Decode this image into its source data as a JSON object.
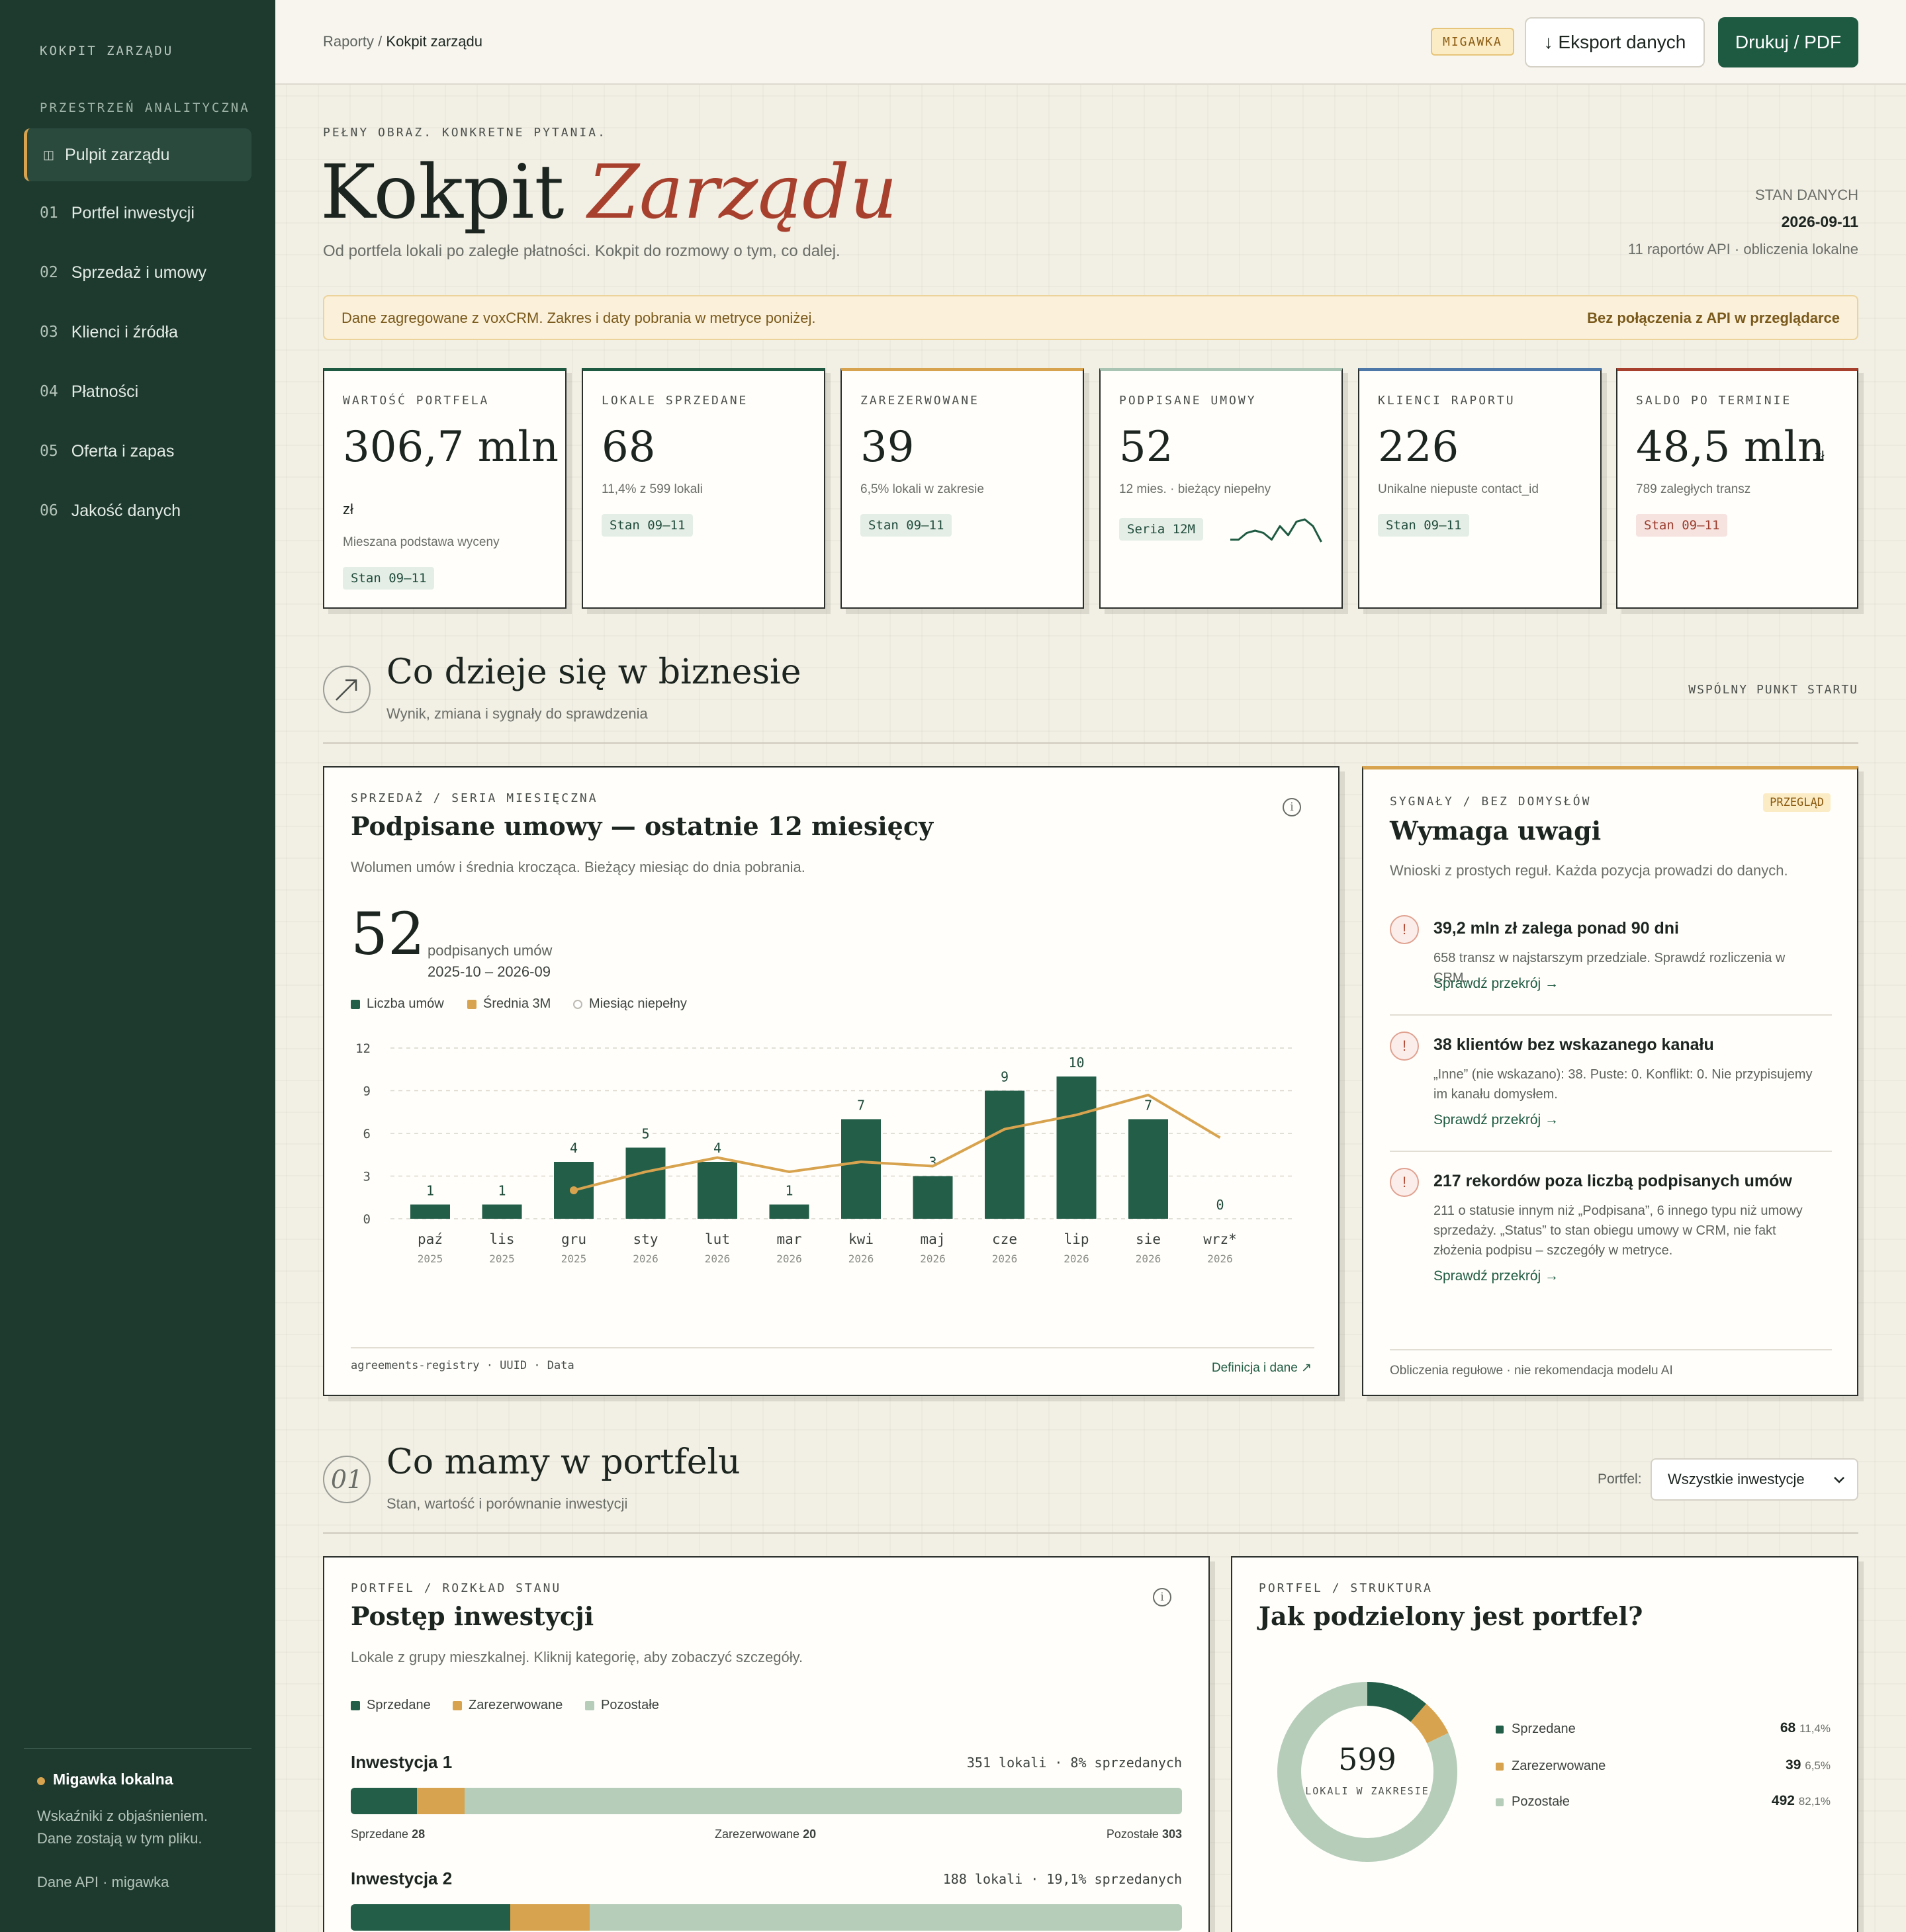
{
  "sidebar": {
    "brand": "KOKPIT ZARZĄDU",
    "section": "PRZESTRZEŃ ANALITYCZNA",
    "active": {
      "icon": "dashboard-icon",
      "label": "Pulpit zarządu"
    },
    "items": [
      {
        "num": "01",
        "label": "Portfel inwestycji"
      },
      {
        "num": "02",
        "label": "Sprzedaż i umowy"
      },
      {
        "num": "03",
        "label": "Klienci i źródła"
      },
      {
        "num": "04",
        "label": "Płatności"
      },
      {
        "num": "05",
        "label": "Oferta i zapas"
      },
      {
        "num": "06",
        "label": "Jakość danych"
      }
    ],
    "footer": {
      "title": "Migawka lokalna",
      "line1": "Wskaźniki z objaśnieniem.",
      "line2": "Dane zostają w tym pliku.",
      "meta": "Dane API · migawka"
    }
  },
  "topbar": {
    "crumb_parent": "Raporty",
    "crumb_sep": "/",
    "crumb_current": "Kokpit zarządu",
    "badge": "MIGAWKA",
    "export_label": "↓ Eksport danych",
    "print_label": "Drukuj / PDF"
  },
  "hero": {
    "eyebrow": "PEŁNY OBRAZ. KONKRETNE PYTANIA.",
    "title_main": "Kokpit",
    "title_accent": "Zarządu",
    "subtitle": "Od portfela lokali po zaległe płatności. Kokpit do rozmowy o tym, co dalej.",
    "status_label": "STAN DANYCH",
    "status_date": "2026-09-11",
    "status_meta": "11 raportów API · obliczenia lokalne"
  },
  "notice": {
    "text": "Dane zagregowane z voxCRM. Zakres i daty pobrania w metryce poniżej.",
    "right": "Bez połączenia z API w przeglądarce"
  },
  "kpis": [
    {
      "label": "WARTOŚĆ PORTFELA",
      "value": "306,7 mln",
      "unit": "zł",
      "sub": "Mieszana podstawa wyceny",
      "tag": "Stan 09–11",
      "accent": "#1e5a42"
    },
    {
      "label": "LOKALE SPRZEDANE",
      "value": "68",
      "sub": "11,4% z 599 lokali",
      "tag": "Stan 09–11",
      "accent": "#1e5a42"
    },
    {
      "label": "ZAREZERWOWANE",
      "value": "39",
      "sub": "6,5% lokali w zakresie",
      "tag": "Stan 09–11",
      "accent": "#d8a34e"
    },
    {
      "label": "PODPISANE UMOWY",
      "value": "52",
      "sub": "12 mies. · bieżący niepełny",
      "tag": "Seria 12M",
      "accent": "#a9c4b3"
    },
    {
      "label": "KLIENCI RAPORTU",
      "value": "226",
      "sub": "Unikalne niepuste contact_id",
      "tag": "Stan 09–11",
      "accent": "#4d78a8"
    },
    {
      "label": "SALDO PO TERMINIE",
      "value": "48,5 mln",
      "unit": "zł",
      "sub": "789 zaległych transz",
      "tag": "Stan 09–11",
      "accent": "#a8402e"
    }
  ],
  "section1": {
    "icon": "trend-arrow-icon",
    "title": "Co dzieje się w biznesie",
    "subtitle": "Wynik, zmiana i sygnały do sprawdzenia",
    "right": "WSPÓLNY PUNKT STARTU"
  },
  "chart_card": {
    "overline": "SPRZEDAŻ / SERIA MIESIĘCZNA",
    "title": "Podpisane umowy — ostatnie 12 miesięcy",
    "desc": "Wolumen umów i średnia krocząca. Bieżący miesiąc do dnia pobrania.",
    "big": "52",
    "big_label": "podpisanych umów",
    "big_range": "2025-10 – 2026-09",
    "legend": [
      "Liczba umów",
      "Średnia 3M",
      "Miesiąc niepełny"
    ],
    "footer_left": "agreements-registry · UUID · Data",
    "footer_right": "Definicja i dane ↗"
  },
  "chart_data": {
    "type": "bar",
    "categories": [
      "paź",
      "lis",
      "gru",
      "sty",
      "lut",
      "mar",
      "kwi",
      "maj",
      "cze",
      "lip",
      "sie",
      "wrz*"
    ],
    "years": [
      "2025",
      "2025",
      "2025",
      "2026",
      "2026",
      "2026",
      "2026",
      "2026",
      "2026",
      "2026",
      "2026",
      "2026"
    ],
    "series": [
      {
        "name": "Liczba umów",
        "type": "bar",
        "values": [
          1,
          1,
          4,
          5,
          4,
          1,
          7,
          3,
          9,
          10,
          7,
          0
        ],
        "color": "#235e48"
      },
      {
        "name": "Średnia 3M",
        "type": "line",
        "values": [
          null,
          null,
          2.0,
          3.3,
          4.3,
          3.3,
          4.0,
          3.7,
          6.3,
          7.3,
          8.7,
          5.7
        ],
        "color": "#d8a34e"
      }
    ],
    "yticks": [
      0,
      3,
      6,
      9,
      12
    ],
    "ylim": [
      0,
      12
    ],
    "grid": true
  },
  "signals": {
    "overline": "SYGNAŁY / BEZ DOMYSŁÓW",
    "badge": "PRZEGLĄD",
    "title": "Wymaga uwagi",
    "desc": "Wnioski z prostych reguł. Każda pozycja prowadzi do danych.",
    "items": [
      {
        "title": "39,2 mln zł zalega ponad 90 dni",
        "desc": "658 transz w najstarszym przedziale. Sprawdź rozliczenia w CRM.",
        "link": "Sprawdź przekrój →"
      },
      {
        "title": "38 klientów bez wskazanego kanału",
        "desc": "„Inne” (nie wskazano): 38. Puste: 0. Konflikt: 0. Nie przypisujemy im kanału domysłem.",
        "link": "Sprawdź przekrój →"
      },
      {
        "title": "217 rekordów poza liczbą podpisanych umów",
        "desc": "211 o statusie innym niż „Podpisana”, 6 innego typu niż umowy sprzedaży. „Status” to stan obiegu umowy w CRM, nie fakt złożenia podpisu – szczegóły w metryce.",
        "link": "Sprawdź przekrój →"
      }
    ],
    "footer": "Obliczenia regułowe · nie rekomendacja modelu AI"
  },
  "section2": {
    "num": "01",
    "title": "Co mamy w portfelu",
    "subtitle": "Stan, wartość i porównanie inwestycji",
    "filter_label": "Portfel:",
    "filter_value": "Wszystkie inwestycje"
  },
  "progress_card": {
    "overline": "PORTFEL / ROZKŁAD STANU",
    "title": "Postęp inwestycji",
    "desc": "Lokale z grupy mieszkalnej. Kliknij kategorię, aby zobaczyć szczegóły.",
    "legend": [
      "Sprzedane",
      "Zarezerwowane",
      "Pozostałe"
    ],
    "investments": [
      {
        "name": "Inwestycja 1",
        "meta": "351 lokali · 8% sprzedanych",
        "sold": 28,
        "reserved": 20,
        "remaining": 303,
        "l_sold": "Sprzedane",
        "l_res": "Zarezerwowane",
        "l_rem": "Pozostałe"
      },
      {
        "name": "Inwestycja 2",
        "meta": "188 lokali · 19,1% sprzedanych",
        "sold": 36,
        "reserved": 18,
        "remaining": 134
      }
    ]
  },
  "structure_card": {
    "overline": "PORTFEL / STRUKTURA",
    "title": "Jak podzielony jest portfel?",
    "total": "599",
    "total_label": "LOKALI W ZAKRESIE",
    "rows": [
      {
        "label": "Sprzedane",
        "value": "68",
        "pct": "11,4%",
        "num": 68,
        "color": "#235e48"
      },
      {
        "label": "Zarezerwowane",
        "value": "39",
        "pct": "6,5%",
        "num": 39,
        "color": "#d8a34e"
      },
      {
        "label": "Pozostałe",
        "value": "492",
        "pct": "82,1%",
        "num": 492,
        "color": "#b6cdb9"
      }
    ]
  }
}
